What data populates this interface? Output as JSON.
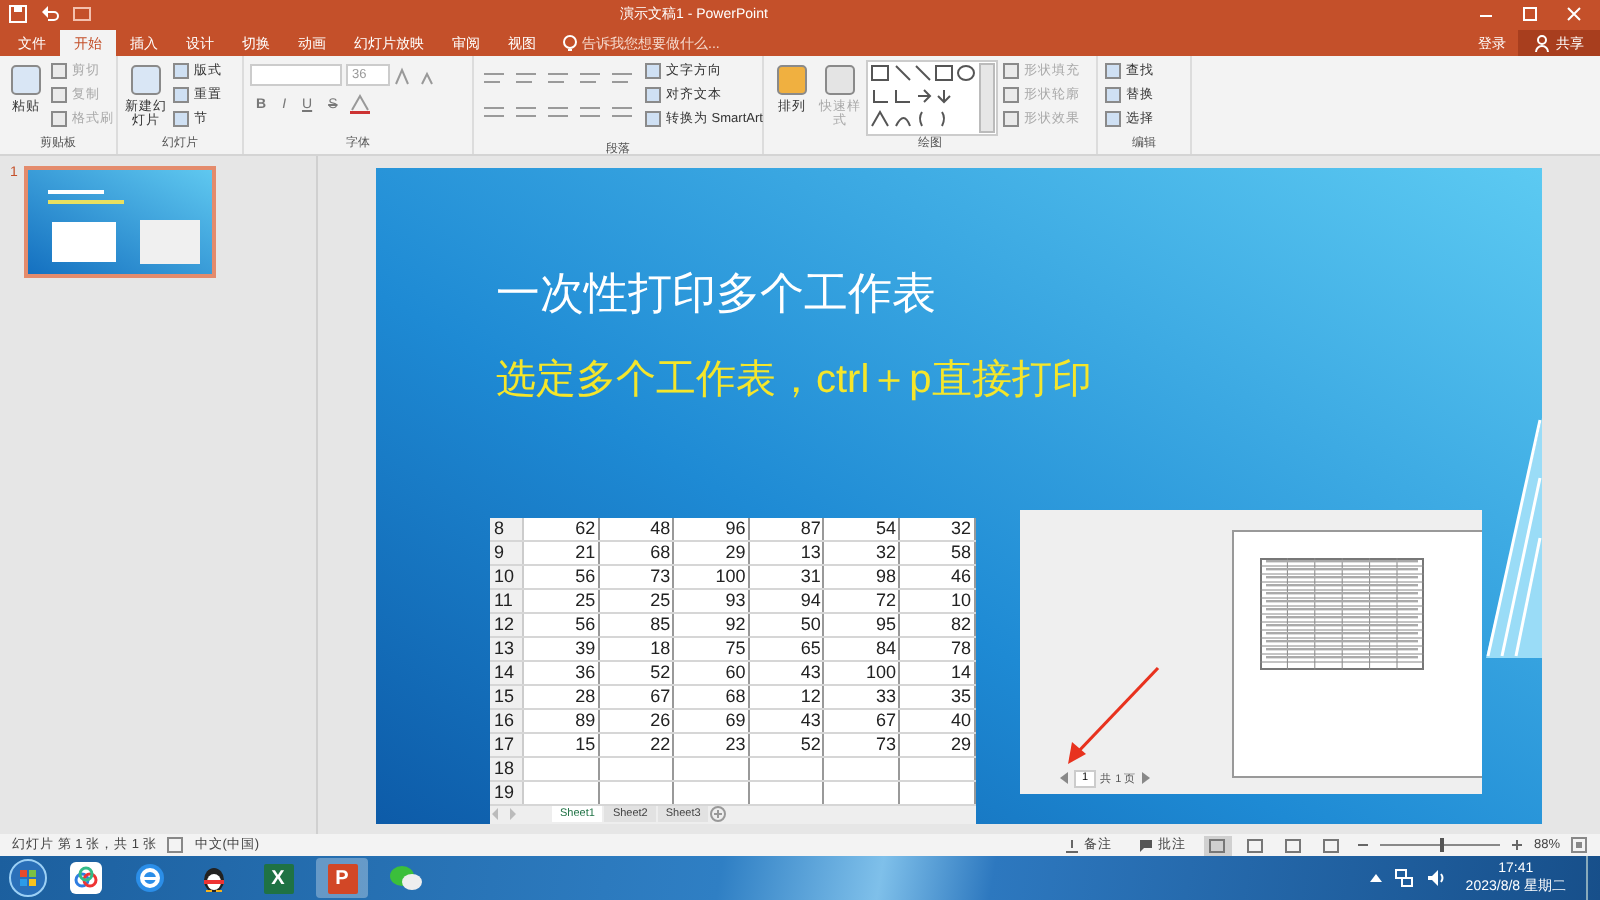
{
  "window": {
    "title": "演示文稿1 - PowerPoint",
    "sign_in": "登录",
    "share": "共享"
  },
  "tabs": [
    {
      "label": "文件",
      "selected": false
    },
    {
      "label": "开始",
      "selected": true
    },
    {
      "label": "插入",
      "selected": false
    },
    {
      "label": "设计",
      "selected": false
    },
    {
      "label": "切换",
      "selected": false
    },
    {
      "label": "动画",
      "selected": false
    },
    {
      "label": "幻灯片放映",
      "selected": false
    },
    {
      "label": "审阅",
      "selected": false
    },
    {
      "label": "视图",
      "selected": false
    }
  ],
  "tell_me": {
    "placeholder": "告诉我您想要做什么..."
  },
  "ribbon": [
    {
      "kind": "clipboard",
      "label": "剪贴板",
      "large": [
        {
          "label": "粘贴",
          "disabled": false
        }
      ],
      "small": [
        {
          "label": "剪切",
          "disabled": true
        },
        {
          "label": "复制",
          "disabled": true
        },
        {
          "label": "格式刷",
          "disabled": true
        }
      ]
    },
    {
      "kind": "slides",
      "label": "幻灯片",
      "large": [
        {
          "label": "新建幻灯片",
          "disabled": false
        }
      ],
      "small": [
        {
          "label": "版式",
          "disabled": false
        },
        {
          "label": "重置",
          "disabled": false
        },
        {
          "label": "节",
          "disabled": false
        }
      ]
    },
    {
      "kind": "font",
      "label": "字体",
      "font_size": "36",
      "format_buttons": [
        "B",
        "I",
        "U",
        "S"
      ]
    },
    {
      "kind": "paragraph",
      "label": "段落",
      "small": [
        {
          "label": "文字方向",
          "disabled": false
        },
        {
          "label": "对齐文本",
          "disabled": false
        },
        {
          "label": "转换为 SmartArt",
          "disabled": false
        }
      ]
    },
    {
      "kind": "drawing",
      "label": "绘图",
      "large": [
        {
          "label": "排列",
          "disabled": false
        },
        {
          "label": "快速样式",
          "disabled": true
        }
      ],
      "small": [
        {
          "label": "形状填充",
          "disabled": true
        },
        {
          "label": "形状轮廓",
          "disabled": true
        },
        {
          "label": "形状效果",
          "disabled": true
        }
      ]
    },
    {
      "kind": "editing",
      "label": "编辑",
      "small": [
        {
          "label": "查找",
          "disabled": false
        },
        {
          "label": "替换",
          "disabled": false
        },
        {
          "label": "选择",
          "disabled": false
        }
      ]
    }
  ],
  "thumbnails": [
    {
      "number": "1",
      "selected": true
    }
  ],
  "slide": {
    "title": "一次性打印多个工作表",
    "subtitle": "选定多个工作表，ctrl＋p直接打印",
    "sheet": {
      "rows": [
        {
          "row": "8",
          "cells": [
            "62",
            "48",
            "96",
            "87",
            "54",
            "32"
          ]
        },
        {
          "row": "9",
          "cells": [
            "21",
            "68",
            "29",
            "13",
            "32",
            "58"
          ]
        },
        {
          "row": "10",
          "cells": [
            "56",
            "73",
            "100",
            "31",
            "98",
            "46"
          ]
        },
        {
          "row": "11",
          "cells": [
            "25",
            "25",
            "93",
            "94",
            "72",
            "10"
          ]
        },
        {
          "row": "12",
          "cells": [
            "56",
            "85",
            "92",
            "50",
            "95",
            "82"
          ]
        },
        {
          "row": "13",
          "cells": [
            "39",
            "18",
            "75",
            "65",
            "84",
            "78"
          ]
        },
        {
          "row": "14",
          "cells": [
            "36",
            "52",
            "60",
            "43",
            "100",
            "14"
          ]
        },
        {
          "row": "15",
          "cells": [
            "28",
            "67",
            "68",
            "12",
            "33",
            "35"
          ]
        },
        {
          "row": "16",
          "cells": [
            "89",
            "26",
            "69",
            "43",
            "67",
            "40"
          ]
        },
        {
          "row": "17",
          "cells": [
            "15",
            "22",
            "23",
            "52",
            "73",
            "29"
          ]
        },
        {
          "row": "18",
          "cells": []
        },
        {
          "row": "19",
          "cells": []
        }
      ],
      "tabs": [
        {
          "label": "Sheet1",
          "selected": true
        },
        {
          "label": "Sheet2",
          "selected": false
        },
        {
          "label": "Sheet3",
          "selected": false
        }
      ]
    },
    "preview": {
      "page": "1",
      "page_total": "共 1 页"
    }
  },
  "status_bar": {
    "slide_info": "幻灯片 第 1 张，共 1 张",
    "language": "中文(中国)",
    "notes": "备注",
    "comments": "批注",
    "views": [
      {
        "selected": true
      },
      {
        "selected": false
      },
      {
        "selected": false
      },
      {
        "selected": false
      }
    ],
    "zoom": "88%",
    "zoom_slider": {
      "level": 0.5
    }
  },
  "taskbar": {
    "apps": [
      {
        "kind": "cloud",
        "active": false
      },
      {
        "kind": "browser",
        "active": false
      },
      {
        "kind": "bird",
        "active": false
      },
      {
        "kind": "excel",
        "letter": "X",
        "active": false
      },
      {
        "kind": "powerpoint",
        "letter": "P",
        "active": true
      },
      {
        "kind": "chat",
        "active": false
      }
    ],
    "time": "17:41",
    "date": "2023/8/8 星期二"
  }
}
